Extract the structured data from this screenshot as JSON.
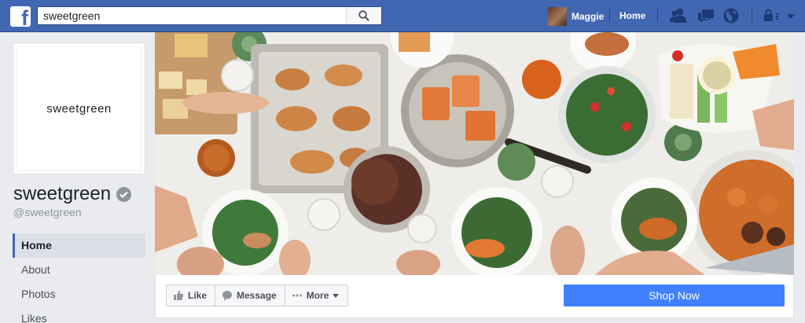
{
  "topbar": {
    "search_value": "sweetgreen",
    "profile_name": "Maggie",
    "home_label": "Home"
  },
  "page": {
    "logo_text": "sweetgreen",
    "name": "sweetgreen",
    "handle": "@sweetgreen"
  },
  "nav": {
    "items": [
      "Home",
      "About",
      "Photos",
      "Likes"
    ],
    "active": "Home"
  },
  "actions": {
    "like_label": "Like",
    "message_label": "Message",
    "more_label": "More",
    "shop_label": "Shop Now"
  },
  "colors": {
    "brand_blue": "#4267b2",
    "shop_button": "#4080ff",
    "page_background": "#e9ebee"
  },
  "icons": {
    "logo": "facebook-logo-icon",
    "search": "search-icon",
    "friends": "friend-requests-icon",
    "messages": "messages-icon",
    "notifications": "globe-notifications-icon",
    "help": "quick-help-lock-icon",
    "menu": "caret-down-icon"
  }
}
